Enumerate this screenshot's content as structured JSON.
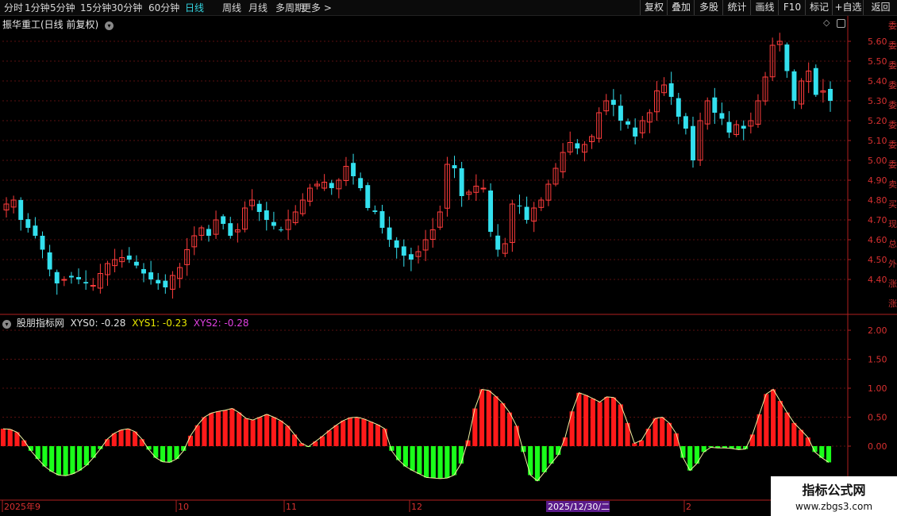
{
  "toolbar": {
    "periods": [
      "分时",
      "1分钟",
      "5分钟",
      "15分钟",
      "30分钟",
      "60分钟",
      "日线",
      "周线",
      "月线",
      "多周期",
      "更多 >"
    ],
    "active_period": "日线",
    "tools": [
      "复权",
      "叠加",
      "多股",
      "统计",
      "画线",
      "F10",
      "标记",
      "+自选",
      "返回"
    ]
  },
  "main_chart": {
    "title": "振华重工(日线 前复权)",
    "price_axis": [
      "5.60",
      "5.50",
      "5.40",
      "5.30",
      "5.20",
      "5.10",
      "5.00",
      "4.90",
      "4.80",
      "4.70",
      "4.60",
      "4.50",
      "4.40"
    ],
    "colors": {
      "up": "#ff3c3c",
      "down": "#33e0ee",
      "grid": "#5a1010",
      "axis": "#b02020"
    }
  },
  "indicator": {
    "name": "股朋指标网",
    "xys0": "XYS0: -0.28",
    "xys1": "XYS1: -0.23",
    "xys2": "XYS2: -0.28",
    "axis": [
      "2.00",
      "1.50",
      "1.00",
      "0.50",
      "0.00"
    ]
  },
  "date_axis": {
    "labels": [
      "2025年9",
      "10",
      "11",
      "12",
      "2"
    ],
    "cursor": "2025/12/30/二"
  },
  "right_strip_text": "委委委委委委委委卖买现总外涨涨收",
  "watermark": {
    "line1": "指标公式网",
    "line2": "www.zbgs3.com"
  },
  "chart_data": [
    {
      "type": "candlestick",
      "title": "振华重工(日线 前复权)",
      "ylim": [
        4.33,
        5.65
      ],
      "ohlc_count": 100,
      "closes_approx": [
        4.78,
        4.8,
        4.7,
        4.66,
        4.62,
        4.55,
        4.45,
        4.38,
        4.4,
        4.41,
        4.4,
        4.38,
        4.37,
        4.43,
        4.48,
        4.5,
        4.51,
        4.5,
        4.47,
        4.43,
        4.4,
        4.38,
        4.36,
        4.42,
        4.46,
        4.55,
        4.62,
        4.66,
        4.62,
        4.7,
        4.68,
        4.62,
        4.65,
        4.76,
        4.8,
        4.74,
        4.7,
        4.67,
        4.65,
        4.7,
        4.74,
        4.8,
        4.86,
        4.88,
        4.89,
        4.86,
        4.9,
        4.97,
        4.92,
        4.86,
        4.76,
        4.74,
        4.66,
        4.6,
        4.56,
        4.52,
        4.5,
        4.54,
        4.6,
        4.65,
        4.74,
        4.98,
        4.96,
        4.82,
        4.84,
        4.87,
        4.86,
        4.64,
        4.55,
        4.58,
        4.78,
        4.77,
        4.7,
        4.76,
        4.8,
        4.88,
        4.96,
        5.04,
        5.09,
        5.06,
        5.08,
        5.12,
        5.24,
        5.3,
        5.28,
        5.2,
        5.18,
        5.12,
        5.2,
        5.24,
        5.35,
        5.38,
        5.32,
        5.22,
        5.16,
        5.0,
        5.2,
        5.3,
        5.24,
        5.21,
        5.14,
        5.18,
        5.16,
        5.2,
        5.3,
        5.42,
        5.58,
        5.6,
        5.45,
        5.3,
        5.4,
        5.45,
        5.33,
        5.35,
        5.3
      ]
    },
    {
      "type": "bar",
      "title": "股朋指标网",
      "ylim": [
        -0.4,
        2.2
      ],
      "series": [
        {
          "name": "XYS0",
          "values": [
            0.3,
            0.29,
            0.24,
            0.1,
            -0.08,
            -0.22,
            -0.35,
            -0.44,
            -0.5,
            -0.51,
            -0.48,
            -0.42,
            -0.33,
            -0.2,
            -0.05,
            0.12,
            0.22,
            0.28,
            0.3,
            0.25,
            0.12,
            -0.06,
            -0.2,
            -0.27,
            -0.28,
            -0.22,
            -0.08,
            0.18,
            0.36,
            0.5,
            0.57,
            0.6,
            0.62,
            0.65,
            0.58,
            0.48,
            0.45,
            0.5,
            0.55,
            0.5,
            0.44,
            0.35,
            0.2,
            0.05,
            -0.01,
            0.08,
            0.17,
            0.27,
            0.36,
            0.44,
            0.49,
            0.5,
            0.47,
            0.42,
            0.37,
            0.3,
            -0.08,
            -0.24,
            -0.35,
            -0.42,
            -0.48,
            -0.54,
            -0.55,
            -0.56,
            -0.55,
            -0.5,
            -0.3,
            0.1,
            0.65,
            0.98,
            0.96,
            0.86,
            0.74,
            0.58,
            0.35,
            -0.1,
            -0.5,
            -0.6,
            -0.45,
            -0.3,
            -0.15,
            0.15,
            0.6,
            0.92,
            0.88,
            0.82,
            0.76,
            0.85,
            0.84,
            0.72,
            0.4,
            0.05,
            0.1,
            0.3,
            0.48,
            0.5,
            0.4,
            0.22,
            -0.2,
            -0.42,
            -0.3,
            -0.1,
            -0.02,
            -0.03,
            -0.03,
            -0.04,
            -0.06,
            -0.05,
            0.2,
            0.55,
            0.9,
            0.98,
            0.78,
            0.58,
            0.4,
            0.28,
            0.15,
            -0.1,
            -0.2,
            -0.28
          ]
        }
      ]
    }
  ]
}
